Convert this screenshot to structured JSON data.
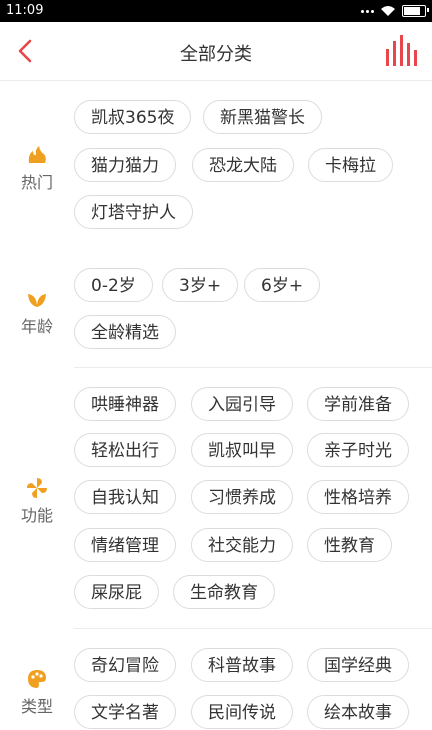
{
  "status_bar": {
    "time": "11:09"
  },
  "header": {
    "title": "全部分类"
  },
  "sections": [
    {
      "id": "hot",
      "label": "热门",
      "tags": [
        "凯叔365夜",
        "新黑猫警长",
        "猫力猫力",
        "恐龙大陆",
        "卡梅拉",
        "灯塔守护人"
      ]
    },
    {
      "id": "age",
      "label": "年龄",
      "tags": [
        "0-2岁",
        "3岁+",
        "6岁+",
        "全龄精选"
      ]
    },
    {
      "id": "function",
      "label": "功能",
      "tags": [
        "哄睡神器",
        "入园引导",
        "学前准备",
        "轻松出行",
        "凯叔叫早",
        "亲子时光",
        "自我认知",
        "习惯养成",
        "性格培养",
        "情绪管理",
        "社交能力",
        "性教育",
        "屎尿屁",
        "生命教育"
      ]
    },
    {
      "id": "type",
      "label": "类型",
      "tags": [
        "奇幻冒险",
        "科普故事",
        "国学经典",
        "文学名著",
        "民间传说",
        "绘本故事"
      ]
    }
  ],
  "colors": {
    "accent": "#e8464a",
    "icon_orange": "#f0a020",
    "border": "#dcdcdc"
  },
  "icons": {
    "back": "chevron-left-icon",
    "chart": "bar-chart-icon",
    "hot": "flame-icon",
    "age": "leaf-icon",
    "function": "pinwheel-icon",
    "type": "palette-icon"
  }
}
